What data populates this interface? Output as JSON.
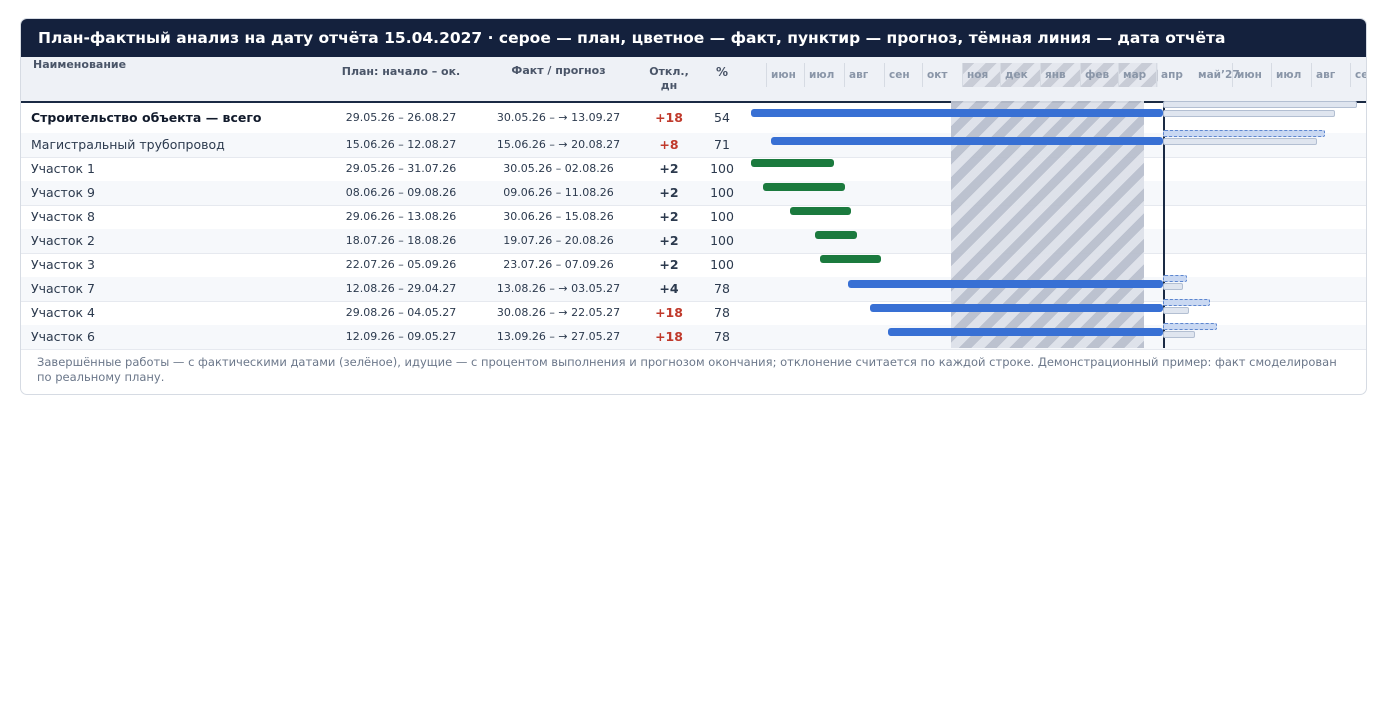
{
  "title": "План-фактный анализ на дату отчёта 15.04.2027 · серое — план, цветное — факт, пунктир — прогноз, тёмная линия — дата отчёта",
  "columns": {
    "name": "Наименование",
    "plan": "План: начало – ок.",
    "fact": "Факт / прогноз",
    "dev": "Откл., дн",
    "pct": "%"
  },
  "months": [
    "июн",
    "июл",
    "авг",
    "сен",
    "окт",
    "ноя",
    "дек",
    "янв",
    "фев",
    "мар",
    "апр",
    "май’27",
    "июн",
    "июл",
    "авг",
    "сен"
  ],
  "rows": [
    {
      "name": "Строительство объекта — всего",
      "plan": "29.05.26 – 26.08.27",
      "fact": "30.05.26 – → 13.09.27",
      "dev": "+18",
      "pct": "54"
    },
    {
      "name": "Магистральный трубопровод",
      "plan": "15.06.26 – 12.08.27",
      "fact": "15.06.26 – → 20.08.27",
      "dev": "+8",
      "pct": "71"
    },
    {
      "name": "Участок 1",
      "plan": "29.05.26 – 31.07.26",
      "fact": "30.05.26 – 02.08.26",
      "dev": "+2",
      "pct": "100"
    },
    {
      "name": "Участок 9",
      "plan": "08.06.26 – 09.08.26",
      "fact": "09.06.26 – 11.08.26",
      "dev": "+2",
      "pct": "100"
    },
    {
      "name": "Участок 8",
      "plan": "29.06.26 – 13.08.26",
      "fact": "30.06.26 – 15.08.26",
      "dev": "+2",
      "pct": "100"
    },
    {
      "name": "Участок 2",
      "plan": "18.07.26 – 18.08.26",
      "fact": "19.07.26 – 20.08.26",
      "dev": "+2",
      "pct": "100"
    },
    {
      "name": "Участок 3",
      "plan": "22.07.26 – 05.09.26",
      "fact": "23.07.26 – 07.09.26",
      "dev": "+2",
      "pct": "100"
    },
    {
      "name": "Участок 7",
      "plan": "12.08.26 – 29.04.27",
      "fact": "13.08.26 – → 03.05.27",
      "dev": "+4",
      "pct": "78"
    },
    {
      "name": "Участок 4",
      "plan": "29.08.26 – 04.05.27",
      "fact": "30.08.26 – → 22.05.27",
      "dev": "+18",
      "pct": "78"
    },
    {
      "name": "Участок 6",
      "plan": "12.09.26 – 09.05.27",
      "fact": "13.09.26 – → 27.05.27",
      "dev": "+18",
      "pct": "78"
    }
  ],
  "note": "Завершённые работы — с фактическими датами (зелёное), идущие — с процентом выполнения и прогнозом окончания; отклонение считается по каждой строке. Демонстрационный пример: факт смоделирован по реальному плану.",
  "colors": {
    "header_bg": "#14213d",
    "fact_running": "#3870d4",
    "fact_done": "#1b7a3e",
    "dev_bad": "#c0392b"
  }
}
